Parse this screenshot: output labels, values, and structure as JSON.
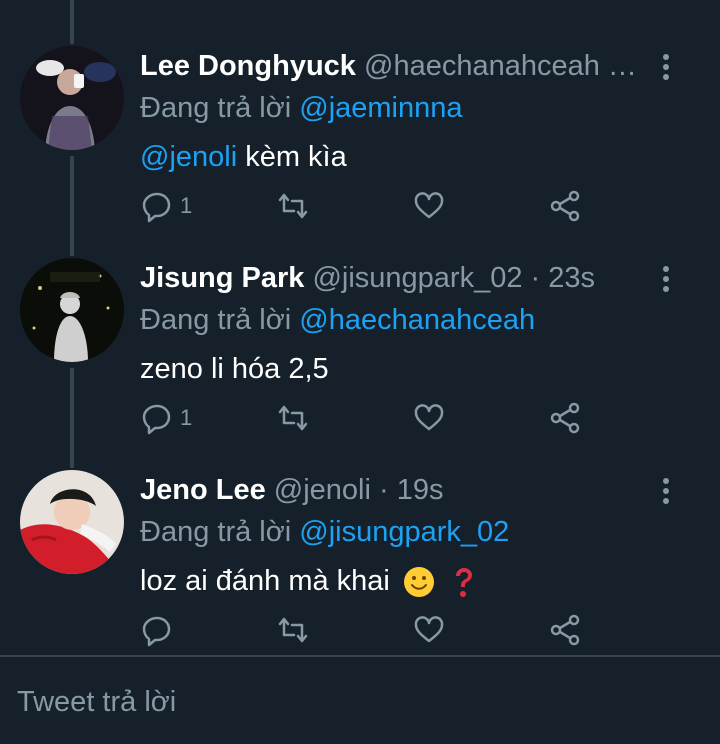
{
  "colors": {
    "background": "#15202b",
    "accent": "#1da1f2",
    "muted": "#8899a6",
    "divider": "#38444d"
  },
  "previous_tweet": {
    "reply_count": "1"
  },
  "tweets": [
    {
      "name": "Lee Donghyuck",
      "handle": "@haechanahceah …",
      "reply_prefix": "Đang trả lời",
      "reply_to": "@jaeminnna",
      "mention": "@jenoli",
      "text": " kèm kìa",
      "reply_count": "1",
      "avatar_icon": "user-avatar"
    },
    {
      "name": "Jisung Park",
      "handle": "@jisungpark_02 · 23s",
      "reply_prefix": "Đang trả lời",
      "reply_to": "@haechanahceah",
      "text": "zeno li hóa 2,5",
      "reply_count": "1",
      "avatar_icon": "user-avatar"
    },
    {
      "name": "Jeno Lee",
      "handle": "@jenoli · 19s",
      "reply_prefix": "Đang trả lời",
      "reply_to": "@jisungpark_02",
      "text": "loz ai đánh mà khai",
      "reply_count": "",
      "avatar_icon": "user-avatar"
    }
  ],
  "compose": {
    "placeholder": "Tweet trả lời"
  }
}
